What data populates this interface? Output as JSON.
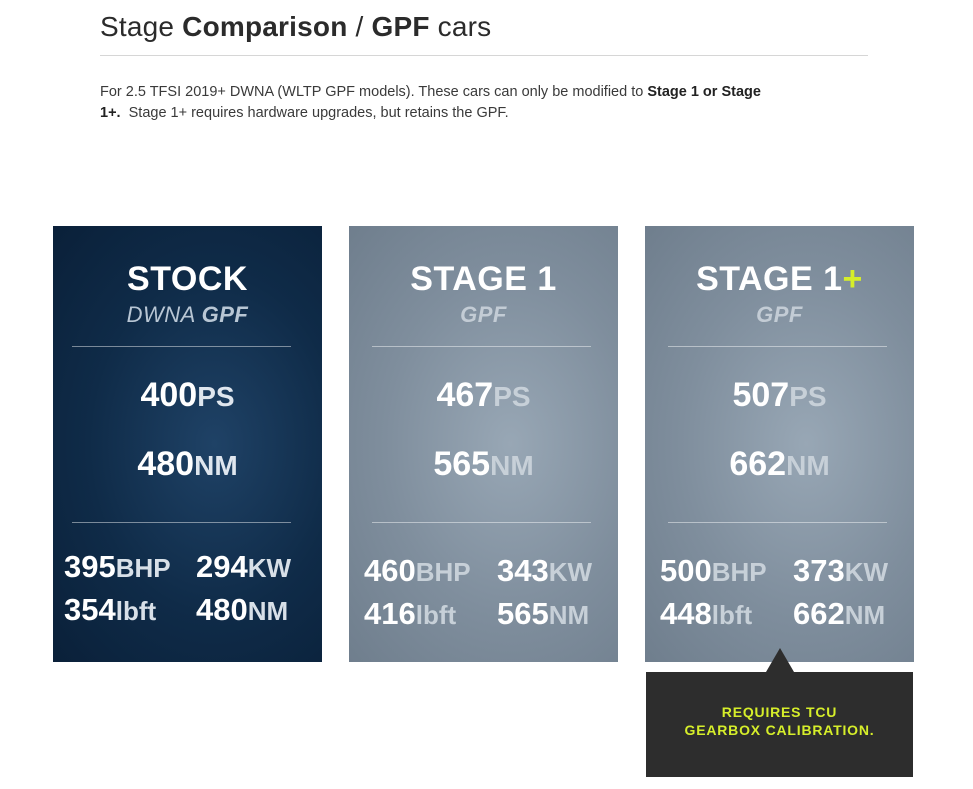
{
  "header": {
    "title_lead": "Stage",
    "title_bold_1": "Comparison",
    "title_sep": "/",
    "title_bold_2": "GPF",
    "title_tail": "cars",
    "intro_text": "For 2.5 TFSI 2019+ DWNA (WLTP GPF models). These cars can only be modified to",
    "intro_bold": "Stage 1 or Stage 1+.",
    "intro_tail": "Stage 1+ requires hardware upgrades, but retains the GPF."
  },
  "cards": {
    "stock": {
      "title": "STOCK",
      "sub_light": "DWNA",
      "sub_bold": "GPF",
      "ps": "400",
      "ps_unit": "PS",
      "nm": "480",
      "nm_unit": "NM",
      "bhp": "395",
      "bhp_unit": "BHP",
      "kw": "294",
      "kw_unit": "KW",
      "lbft": "354",
      "lbft_unit": "lbft",
      "nm2": "480",
      "nm2_unit": "NM"
    },
    "stage1": {
      "title": "STAGE 1",
      "sub_bold": "GPF",
      "ps": "467",
      "ps_unit": "PS",
      "nm": "565",
      "nm_unit": "NM",
      "bhp": "460",
      "bhp_unit": "BHP",
      "kw": "343",
      "kw_unit": "KW",
      "lbft": "416",
      "lbft_unit": "lbft",
      "nm2": "565",
      "nm2_unit": "NM"
    },
    "stage1plus": {
      "title": "STAGE 1",
      "title_plus": "+",
      "sub_bold": "GPF",
      "ps": "507",
      "ps_unit": "PS",
      "nm": "662",
      "nm_unit": "NM",
      "bhp": "500",
      "bhp_unit": "BHP",
      "kw": "373",
      "kw_unit": "KW",
      "lbft": "448",
      "lbft_unit": "lbft",
      "nm2": "662",
      "nm2_unit": "NM"
    }
  },
  "callout": {
    "line1": "REQUIRES TCU",
    "line2": "GEARBOX CALIBRATION."
  },
  "colors": {
    "stock_card": "#0f2b48",
    "stage_card": "#7f8e9d",
    "accent": "#d6ee2a",
    "callout_bg": "#2d2d2d"
  }
}
